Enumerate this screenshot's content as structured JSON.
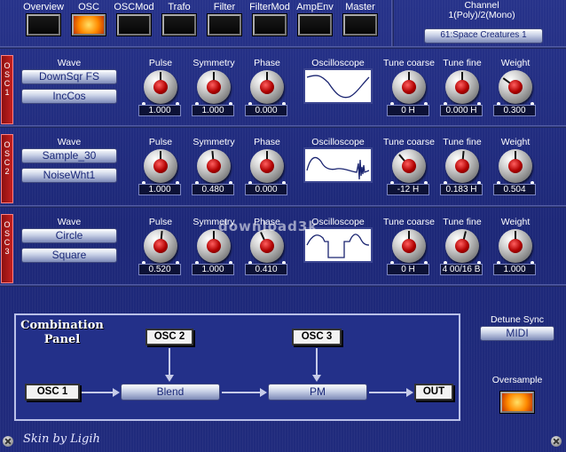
{
  "nav": {
    "tabs": [
      {
        "label": "Overview",
        "active": false
      },
      {
        "label": "OSC",
        "active": true
      },
      {
        "label": "OSCMod",
        "active": false
      },
      {
        "label": "Trafo",
        "active": false
      },
      {
        "label": "Filter",
        "active": false
      },
      {
        "label": "FilterMod",
        "active": false
      },
      {
        "label": "AmpEnv",
        "active": false
      },
      {
        "label": "Master",
        "active": false
      }
    ]
  },
  "channel": {
    "title": "Channel",
    "mode": "1(Poly)/2(Mono)",
    "preset": "61:Space Creatures 1"
  },
  "column_labels": {
    "wave": "Wave",
    "pulse": "Pulse",
    "symmetry": "Symmetry",
    "phase": "Phase",
    "oscilloscope": "Oscilloscope",
    "tune_coarse": "Tune coarse",
    "tune_fine": "Tune fine",
    "weight": "Weight"
  },
  "oscillators": [
    {
      "tab": "OSC 1",
      "wave1": "DownSqr FS",
      "wave2": "IncCos",
      "pulse": "1.000",
      "symmetry": "1.000",
      "phase": "0.000",
      "tune_coarse": "0 H",
      "tune_fine": "0.000 H",
      "weight": "0.300",
      "knob_levels": {
        "pulse": 0.5,
        "symmetry": 0.5,
        "phase": 0.5,
        "tune_coarse": 0.5,
        "tune_fine": 0.5,
        "weight": 0.3
      }
    },
    {
      "tab": "OSC 2",
      "wave1": "Sample_30",
      "wave2": "NoiseWht1",
      "pulse": "1.000",
      "symmetry": "0.480",
      "phase": "0.000",
      "tune_coarse": "-12 H",
      "tune_fine": "0.183 H",
      "weight": "0.504",
      "knob_levels": {
        "pulse": 0.5,
        "symmetry": 0.48,
        "phase": 0.5,
        "tune_coarse": 0.35,
        "tune_fine": 0.52,
        "weight": 0.5
      }
    },
    {
      "tab": "OSC 3",
      "wave1": "Circle",
      "wave2": "Square",
      "pulse": "0.520",
      "symmetry": "1.000",
      "phase": "0.410",
      "tune_coarse": "0 H",
      "tune_fine": "4 00/16 B",
      "weight": "1.000",
      "knob_levels": {
        "pulse": 0.52,
        "symmetry": 0.5,
        "phase": 0.41,
        "tune_coarse": 0.5,
        "tune_fine": 0.55,
        "weight": 0.5
      }
    }
  ],
  "combination": {
    "title": "Combination Panel",
    "osc1": "OSC 1",
    "osc2": "OSC 2",
    "osc3": "OSC 3",
    "blend": "Blend",
    "pm": "PM",
    "out": "OUT"
  },
  "detune_sync": {
    "label": "Detune Sync",
    "value": "MIDI"
  },
  "oversample": {
    "label": "Oversample"
  },
  "footer": {
    "skin": "Skin by Ligih"
  },
  "watermark": "download3k",
  "colors": {
    "background": "#1c2676",
    "led_on": "#ff8a00",
    "osc_tab": "#c42020",
    "knob_cap": "#b00000"
  }
}
